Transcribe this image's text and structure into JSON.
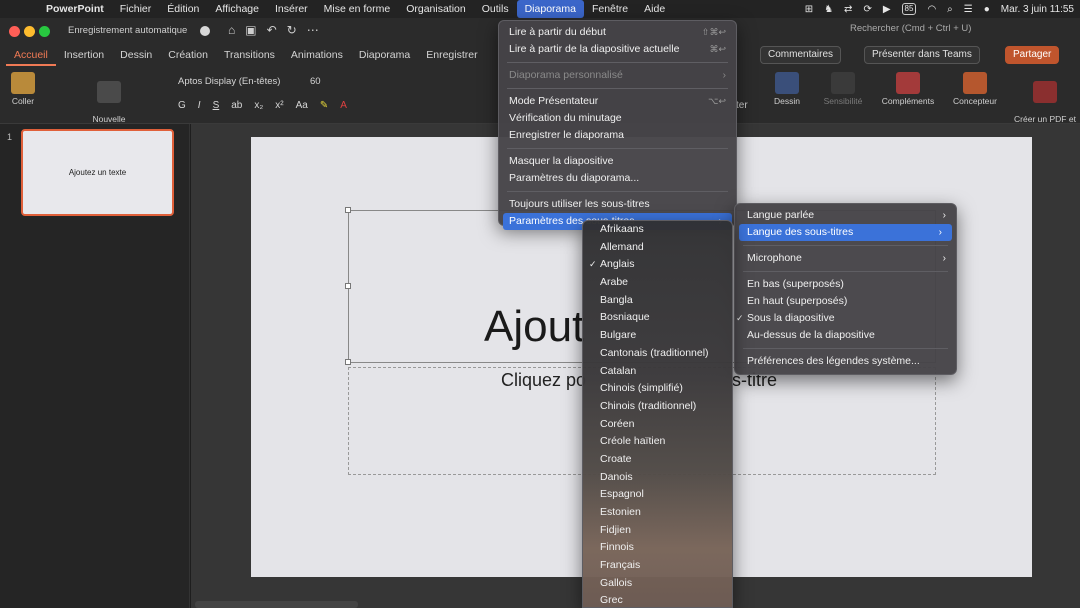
{
  "menubar": {
    "app": "PowerPoint",
    "items": [
      "Fichier",
      "Édition",
      "Affichage",
      "Insérer",
      "Mise en forme",
      "Organisation",
      "Outils",
      "Diaporama",
      "Fenêtre",
      "Aide"
    ],
    "active": "Diaporama",
    "datetime": "Mar. 3 juin  11:55",
    "battery_badge": "85"
  },
  "titlebar": {
    "autosave": "Enregistrement automatique",
    "search": "Rechercher (Cmd + Ctrl + U)"
  },
  "ribbon_tabs": [
    "Accueil",
    "Insertion",
    "Dessin",
    "Création",
    "Transitions",
    "Animations",
    "Diaporama",
    "Enregistrer"
  ],
  "ribbon_buttons": {
    "comments": "Commentaires",
    "teams": "Présenter dans Teams",
    "share": "Partager"
  },
  "ribbon": {
    "paste": "Coller",
    "new_slide": "Nouvelle\ndiapositive",
    "font": "Aptos Display (En-têtes)",
    "size": "60",
    "dessin": "Dessin",
    "sensibilite": "Sensibilité",
    "complements": "Compléments",
    "concepteur": "Concepteur",
    "pdf": "Créer un PDF et\npartager le lien",
    "partial_er": "er",
    "partial_ter": "ter"
  },
  "thumbnail": {
    "number": "1",
    "text": "Ajoutez un texte"
  },
  "slide": {
    "title_visible": "Ajout",
    "subtitle_left": "Cliquez po",
    "subtitle_right": "s-titre"
  },
  "menu_diaporama": {
    "play_start": "Lire à partir du début",
    "play_start_sc": "⇧⌘↩",
    "play_current": "Lire à partir de la diapositive actuelle",
    "play_current_sc": "⌘↩",
    "custom": "Diaporama personnalisé",
    "presenter": "Mode Présentateur",
    "presenter_sc": "⌥↩",
    "rehearse": "Vérification du minutage",
    "record": "Enregistrer le diaporama",
    "hide": "Masquer la diapositive",
    "settings": "Paramètres du diaporama...",
    "always_subtitles": "Toujours utiliser les sous-titres",
    "subtitle_settings": "Paramètres des sous-titres"
  },
  "menu_soustitres": {
    "spoken": "Langue parlée",
    "subtitle_lang": "Langue des sous-titres",
    "microphone": "Microphone",
    "bottom_overlay": "En bas (superposés)",
    "top_overlay": "En haut (superposés)",
    "below_slide": "Sous la diapositive",
    "above_slide": "Au-dessus de la diapositive",
    "system_prefs": "Préférences des légendes système..."
  },
  "languages": [
    "Afrikaans",
    "Allemand",
    "Anglais",
    "Arabe",
    "Bangla",
    "Bosniaque",
    "Bulgare",
    "Cantonais (traditionnel)",
    "Catalan",
    "Chinois (simplifié)",
    "Chinois (traditionnel)",
    "Coréen",
    "Créole haïtien",
    "Croate",
    "Danois",
    "Espagnol",
    "Estonien",
    "Fidjien",
    "Finnois",
    "Français",
    "Gallois",
    "Grec"
  ],
  "selected_language": "Anglais"
}
